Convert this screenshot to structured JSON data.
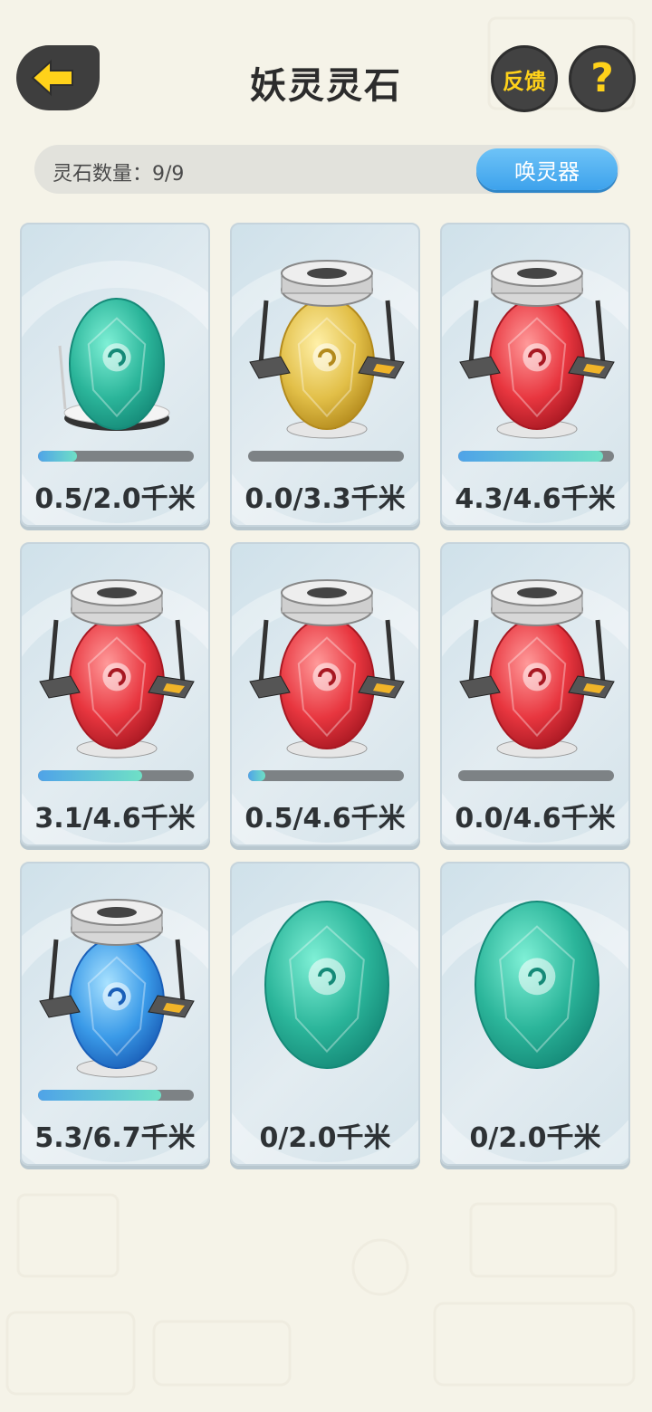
{
  "header": {
    "title": "妖灵灵石",
    "feedback_label": "反馈",
    "help_label": "?"
  },
  "status": {
    "count_text": "灵石数量：9/9",
    "summon_label": "唤灵器"
  },
  "colors": {
    "accent_yellow": "#ffd21a",
    "button_blue": "#3da2ec",
    "progress_fill": "#4fa3e8"
  },
  "eggs": [
    {
      "color": "teal",
      "incubator": "small-stand",
      "progress": 0.25,
      "distance": "0.5/2.0千米"
    },
    {
      "color": "gold",
      "incubator": "full-incubator",
      "progress": 0.0,
      "distance": "0.0/3.3千米"
    },
    {
      "color": "red",
      "incubator": "full-incubator",
      "progress": 0.93,
      "distance": "4.3/4.6千米"
    },
    {
      "color": "red",
      "incubator": "full-incubator",
      "progress": 0.67,
      "distance": "3.1/4.6千米"
    },
    {
      "color": "red",
      "incubator": "full-incubator",
      "progress": 0.11,
      "distance": "0.5/4.6千米"
    },
    {
      "color": "red",
      "incubator": "full-incubator",
      "progress": 0.0,
      "distance": "0.0/4.6千米"
    },
    {
      "color": "blue",
      "incubator": "full-incubator",
      "progress": 0.79,
      "distance": "5.3/6.7千米"
    },
    {
      "color": "teal",
      "incubator": "none",
      "progress": null,
      "distance": "0/2.0千米"
    },
    {
      "color": "teal",
      "incubator": "none",
      "progress": null,
      "distance": "0/2.0千米"
    }
  ]
}
